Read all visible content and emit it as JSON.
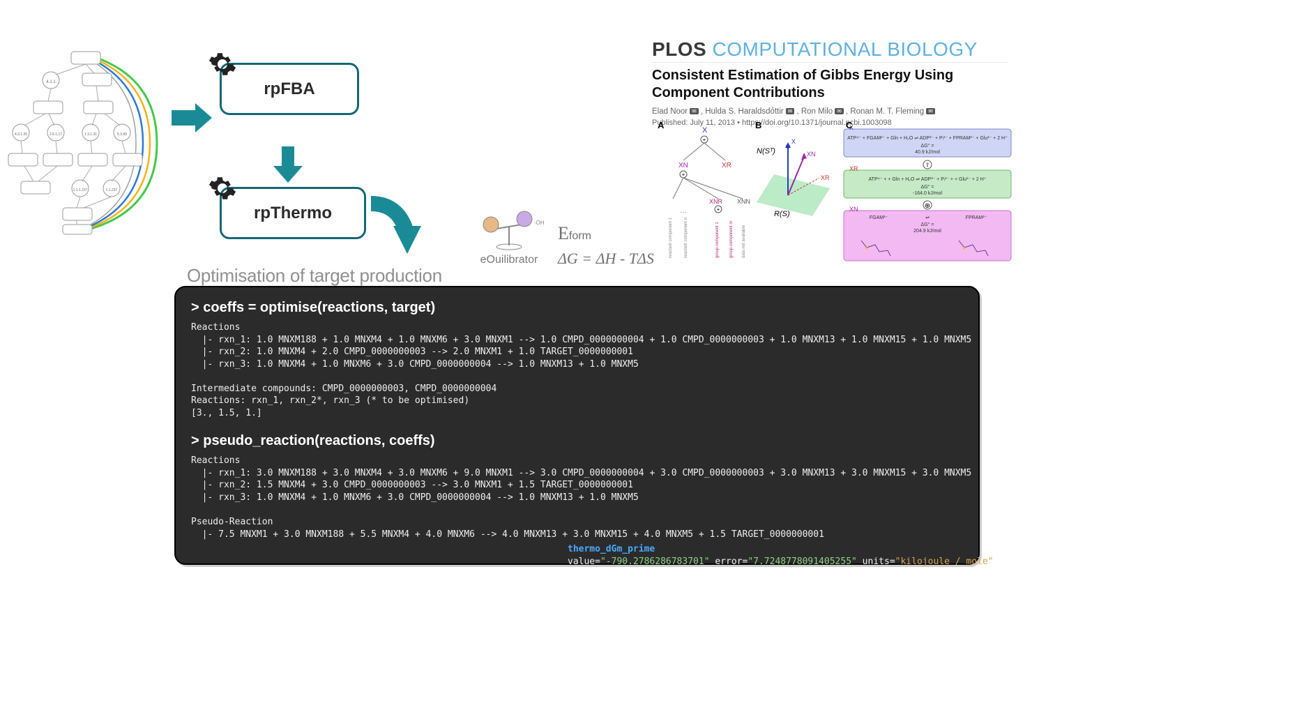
{
  "pipeline": {
    "box1": "rpFBA",
    "box2": "rpThermo",
    "caption": "Optimisation of target production"
  },
  "equilibrator": {
    "label": "eOuilibrator",
    "eform": "Eform",
    "gibbs_eq": "ΔG = ΔH - TΔS"
  },
  "plos": {
    "journal_a": "PLOS ",
    "journal_b": "COMPUTATIONAL BIOLOGY",
    "title": "Consistent Estimation of Gibbs Energy Using Component Contributions",
    "authors": [
      "Elad Noor",
      "Hulda S. Haraldsdóttir",
      "Ron Milo",
      "Ronan M. T. Fleming"
    ],
    "pub": "Published: July 11, 2013 • https://doi.org/10.1371/journal.pcbi.1003098",
    "fig": {
      "labels": {
        "A": "A",
        "B": "B",
        "C": "C",
        "X": "X",
        "XR": "XR",
        "XN": "XN",
        "XNR": "XNR",
        "XNN": "XNN",
        "NS": "N(Sᵀ)",
        "RS": "R(S)"
      },
      "panelC": {
        "top": {
          "lhs": "ATP⁴⁻ + FGAM²⁻ + Gln + H₂O",
          "rhs": "ADP³⁻ + Pᵢ²⁻ + FPRAM²⁻ + Glu¹⁻ + 2 H⁺",
          "dg": "ΔG° =",
          "val": "40.9 kJ/mol"
        },
        "mid": {
          "lhs": "ATP⁴⁻ +        + Gln + H₂O",
          "rhs": "ADP³⁻ + Pᵢ²⁻ +          + Glu¹⁻ + 2 H⁺",
          "dg": "ΔG° =",
          "val": "-164.0 kJ/mol"
        },
        "bot": {
          "lhs": "FGAM²⁻",
          "rhs": "FPRAM²⁻",
          "dg": "ΔG° =",
          "val": "204.9 kJ/mol"
        }
      }
    }
  },
  "terminal": {
    "prompt1": "> coeffs = optimise(reactions, target)",
    "out1": "Reactions\n  |- rxn_1: 1.0 MNXM188 + 1.0 MNXM4 + 1.0 MNXM6 + 3.0 MNXM1 --> 1.0 CMPD_0000000004 + 1.0 CMPD_0000000003 + 1.0 MNXM13 + 1.0 MNXM15 + 1.0 MNXM5\n  |- rxn_2: 1.0 MNXM4 + 2.0 CMPD_0000000003 --> 2.0 MNXM1 + 1.0 TARGET_0000000001\n  |- rxn_3: 1.0 MNXM4 + 1.0 MNXM6 + 3.0 CMPD_0000000004 --> 1.0 MNXM13 + 1.0 MNXM5\n\nIntermediate compounds: CMPD_0000000003, CMPD_0000000004\nReactions: rxn_1, rxn_2*, rxn_3 (* to be optimised)\n[3., 1.5, 1.]",
    "prompt2": "> pseudo_reaction(reactions, coeffs)",
    "out2": "Reactions\n  |- rxn_1: 3.0 MNXM188 + 3.0 MNXM4 + 3.0 MNXM6 + 9.0 MNXM1 --> 3.0 CMPD_0000000004 + 3.0 CMPD_0000000003 + 3.0 MNXM13 + 3.0 MNXM15 + 3.0 MNXM5\n  |- rxn_2: 1.5 MNXM4 + 3.0 CMPD_0000000003 --> 3.0 MNXM1 + 1.5 TARGET_0000000001\n  |- rxn_3: 1.0 MNXM4 + 1.0 MNXM6 + 3.0 CMPD_0000000004 --> 1.0 MNXM13 + 1.0 MNXM5\n\nPseudo-Reaction\n  |- 7.5 MNXM1 + 3.0 MNXM188 + 5.5 MNXM4 + 4.0 MNXM6 --> 4.0 MNXM13 + 3.0 MNXM15 + 4.0 MNXM5 + 1.5 TARGET_0000000001",
    "thermo": {
      "key": "thermo_dGm_prime",
      "value": "-790.2786286783701",
      "error": "7.7248778091405255",
      "units": "kilojoule / mole"
    }
  },
  "network": {
    "ec": [
      "4.1.1",
      "4.3.1.25",
      "2.6.1.17",
      "1.3.1.31",
      "5.3.99",
      "1.1.1.237",
      "1.1.237"
    ]
  }
}
